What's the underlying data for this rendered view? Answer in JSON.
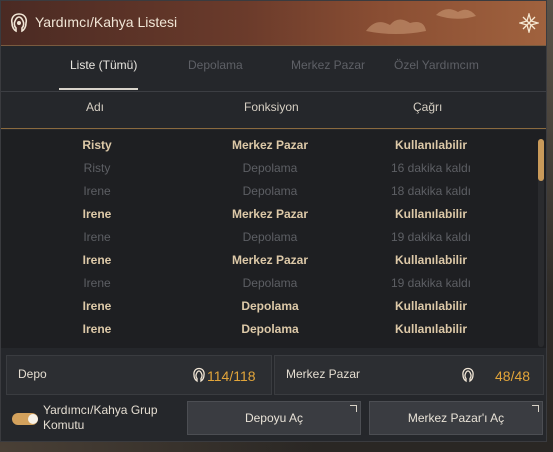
{
  "window": {
    "title": "Yardımcı/Kahya Listesi"
  },
  "tabs": [
    {
      "label": "Liste (Tümü)",
      "active": true
    },
    {
      "label": "Depolama",
      "active": false
    },
    {
      "label": "Merkez Pazar",
      "active": false
    },
    {
      "label": "Özel Yardımcım",
      "active": false
    }
  ],
  "columns": {
    "name": "Adı",
    "function": "Fonksiyon",
    "call": "Çağrı"
  },
  "rows": [
    {
      "name": "Risty",
      "function": "Merkez Pazar",
      "call": "Kullanılabilir",
      "available": true
    },
    {
      "name": "Risty",
      "function": "Depolama",
      "call": "16 dakika kaldı",
      "available": false
    },
    {
      "name": "Irene",
      "function": "Depolama",
      "call": "18 dakika kaldı",
      "available": false
    },
    {
      "name": "Irene",
      "function": "Merkez Pazar",
      "call": "Kullanılabilir",
      "available": true
    },
    {
      "name": "Irene",
      "function": "Depolama",
      "call": "19 dakika kaldı",
      "available": false
    },
    {
      "name": "Irene",
      "function": "Merkez Pazar",
      "call": "Kullanılabilir",
      "available": true
    },
    {
      "name": "Irene",
      "function": "Depolama",
      "call": "19 dakika kaldı",
      "available": false
    },
    {
      "name": "Irene",
      "function": "Depolama",
      "call": "Kullanılabilir",
      "available": true
    },
    {
      "name": "Irene",
      "function": "Depolama",
      "call": "Kullanılabilir",
      "available": true
    }
  ],
  "stats": {
    "storage": {
      "label": "Depo",
      "value": "114/118",
      "icon": "helper-head-icon"
    },
    "market": {
      "label": "Merkez Pazar",
      "value": "48/48",
      "icon": "helper-head-icon"
    }
  },
  "bottom": {
    "toggle_label": "Yardımcı/Kahya Grup Komutu",
    "toggle_on": true,
    "open_storage": "Depoyu Aç",
    "open_market": "Merkez Pazar'ı Aç"
  },
  "colors": {
    "accent": "#e2a53a",
    "available_text": "#ddc9a8",
    "unavailable_text": "#5d5f64"
  }
}
